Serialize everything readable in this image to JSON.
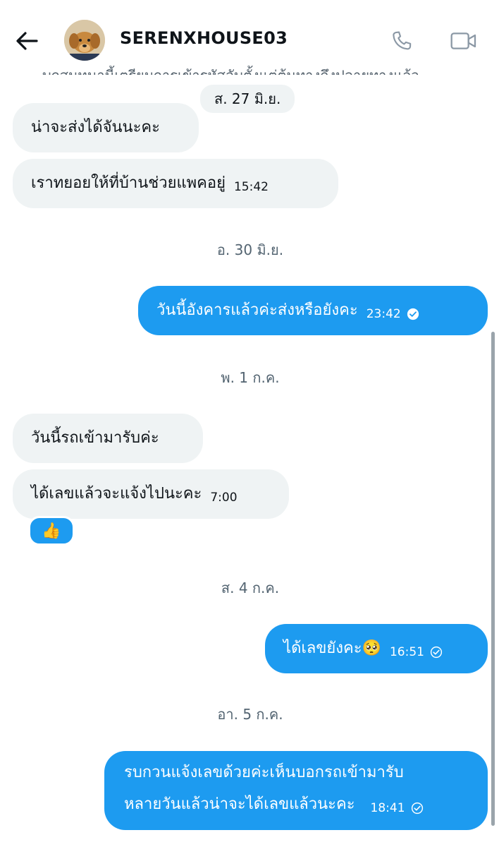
{
  "header": {
    "username": "SERENXHOUSE03",
    "cut_text": "บุกสนทนานี้เตรียมการเข้ารหัสลับตั้งแต่ต้นทางถึงปลายทางแล้ว"
  },
  "icons": {
    "back": "arrow-left-icon",
    "call": "phone-icon",
    "video": "video-camera-icon",
    "read": "check-circle-icon"
  },
  "colors": {
    "sent_bubble": "#1d9bf0",
    "received_bubble": "#eff3f4"
  },
  "messages": [
    {
      "date": "ส. 27 มิ.ย."
    },
    {
      "text": "น่าจะส่งได้จันนะคะ"
    },
    {
      "text": "เราทยอยให้ที่บ้านช่วยแพคอยู่",
      "time": "15:42"
    },
    {
      "date": "อ. 30 มิ.ย."
    },
    {
      "text": "วันนี้อังคารแล้วค่ะส่งหรือยังคะ",
      "time": "23:42"
    },
    {
      "date": "พ. 1 ก.ค."
    },
    {
      "text": "วันนี้รถเข้ามารับค่ะ"
    },
    {
      "text": "ได้เลขแล้วจะแจ้งไปนะคะ",
      "time": "7:00",
      "reaction": "👍"
    },
    {
      "date": "ส. 4 ก.ค."
    },
    {
      "text": "ได้เลขยังคะ🥺",
      "time": "16:51"
    },
    {
      "date": "อา. 5 ก.ค."
    },
    {
      "line1": "รบกวนแจ้งเลขด้วยค่ะเห็นบอกรถเข้ามารับ",
      "line2": "หลายวันแล้วน่าจะได้เลขแล้วนะคะ",
      "time": "18:41"
    }
  ]
}
